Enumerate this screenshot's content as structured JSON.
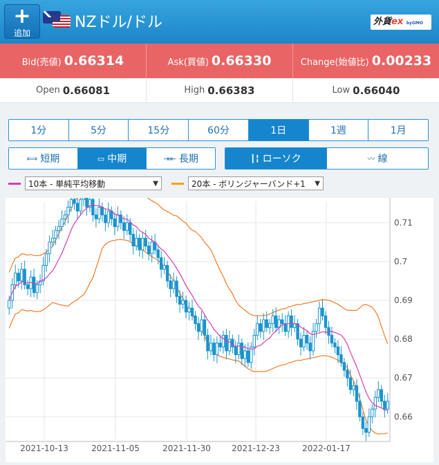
{
  "header": {
    "add_label": "追加",
    "title": "NZドル/ドル",
    "logo_main": "外貨ex",
    "logo_sub": "byGMO"
  },
  "quote": {
    "bid_label": "Bid(売値)",
    "bid_value": "0.66314",
    "ask_label": "Ask(買値)",
    "ask_value": "0.66330",
    "change_label": "Change(始値比)",
    "change_value": "0.00233"
  },
  "stats": {
    "open_label": "Open",
    "open_value": "0.66081",
    "high_label": "High",
    "high_value": "0.66383",
    "low_label": "Low",
    "low_value": "0.66040"
  },
  "timeframes": [
    "1分",
    "5分",
    "15分",
    "60分",
    "1日",
    "1週",
    "1月"
  ],
  "active_timeframe": "1日",
  "range": {
    "short": "短期",
    "mid": "中期",
    "long": "長期",
    "active": "中期"
  },
  "style": {
    "candle": "ローソク",
    "line": "線",
    "active": "ローソク"
  },
  "indicators": {
    "ma": {
      "label": "10本 - 単純平均移動",
      "color": "#d63bb3"
    },
    "bb": {
      "label": "20本 - ボリンジャーバンド+1",
      "color": "#f3a313"
    }
  },
  "chart_data": {
    "type": "candlestick",
    "y_ticks": [
      "0.71",
      "0.7",
      "0.69",
      "0.68",
      "0.67",
      "0.66"
    ],
    "ylim": [
      0.654,
      0.7155
    ],
    "x_ticks": [
      "2021-10-13",
      "2021-11-05",
      "2021-11-30",
      "2021-12-23",
      "2022-01-17"
    ],
    "grid": true,
    "candle_color": "#1a94cc",
    "ma_color": "#d63bb3",
    "bb_color": "#f07a27",
    "close_series": [
      0.69,
      0.694,
      0.697,
      0.695,
      0.698,
      0.694,
      0.693,
      0.696,
      0.692,
      0.694,
      0.695,
      0.699,
      0.702,
      0.705,
      0.706,
      0.708,
      0.709,
      0.711,
      0.712,
      0.714,
      0.716,
      0.715,
      0.713,
      0.716,
      0.717,
      0.714,
      0.716,
      0.712,
      0.711,
      0.714,
      0.712,
      0.71,
      0.713,
      0.711,
      0.709,
      0.712,
      0.71,
      0.708,
      0.71,
      0.707,
      0.704,
      0.706,
      0.703,
      0.706,
      0.704,
      0.702,
      0.705,
      0.703,
      0.701,
      0.698,
      0.699,
      0.695,
      0.693,
      0.695,
      0.691,
      0.689,
      0.69,
      0.687,
      0.688,
      0.686,
      0.684,
      0.682,
      0.685,
      0.681,
      0.677,
      0.679,
      0.676,
      0.679,
      0.678,
      0.681,
      0.677,
      0.68,
      0.678,
      0.676,
      0.679,
      0.675,
      0.677,
      0.674,
      0.678,
      0.681,
      0.684,
      0.682,
      0.685,
      0.683,
      0.684,
      0.686,
      0.683,
      0.685,
      0.684,
      0.682,
      0.686,
      0.683,
      0.684,
      0.68,
      0.678,
      0.681,
      0.679,
      0.677,
      0.682,
      0.684,
      0.688,
      0.686,
      0.683,
      0.681,
      0.679,
      0.678,
      0.676,
      0.674,
      0.672,
      0.67,
      0.667,
      0.668,
      0.664,
      0.66,
      0.657,
      0.656,
      0.66,
      0.662,
      0.665,
      0.667,
      0.664,
      0.662,
      0.664
    ]
  }
}
